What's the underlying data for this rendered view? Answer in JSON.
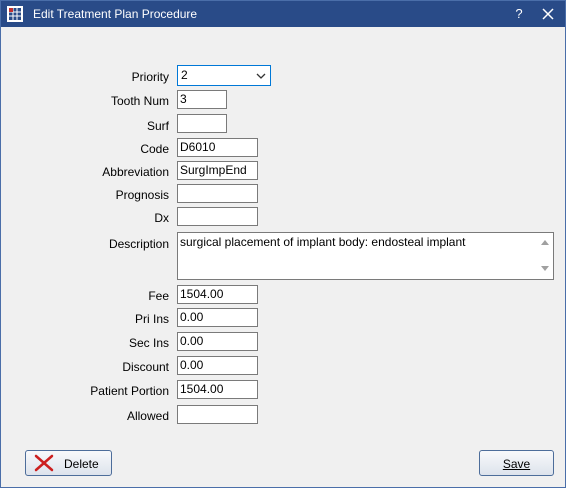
{
  "window": {
    "title": "Edit Treatment Plan Procedure",
    "help_label": "?"
  },
  "form": {
    "priority": {
      "label": "Priority",
      "value": "2"
    },
    "tooth_num": {
      "label": "Tooth Num",
      "value": "3"
    },
    "surf": {
      "label": "Surf",
      "value": ""
    },
    "code": {
      "label": "Code",
      "value": "D6010"
    },
    "abbreviation": {
      "label": "Abbreviation",
      "value": "SurgImpEnd"
    },
    "prognosis": {
      "label": "Prognosis",
      "value": ""
    },
    "dx": {
      "label": "Dx",
      "value": ""
    },
    "description": {
      "label": "Description",
      "value": "surgical placement of implant body: endosteal implant"
    },
    "fee": {
      "label": "Fee",
      "value": "1504.00"
    },
    "pri_ins": {
      "label": "Pri Ins",
      "value": "0.00"
    },
    "sec_ins": {
      "label": "Sec Ins",
      "value": "0.00"
    },
    "discount": {
      "label": "Discount",
      "value": "0.00"
    },
    "patient_portion": {
      "label": "Patient Portion",
      "value": "1504.00"
    },
    "allowed": {
      "label": "Allowed",
      "value": ""
    }
  },
  "buttons": {
    "delete_label": "Delete",
    "save_label": "Save"
  },
  "colors": {
    "titlebar": "#294b88",
    "delete_icon": "#cc1f1f",
    "focus_border": "#0078d7"
  }
}
